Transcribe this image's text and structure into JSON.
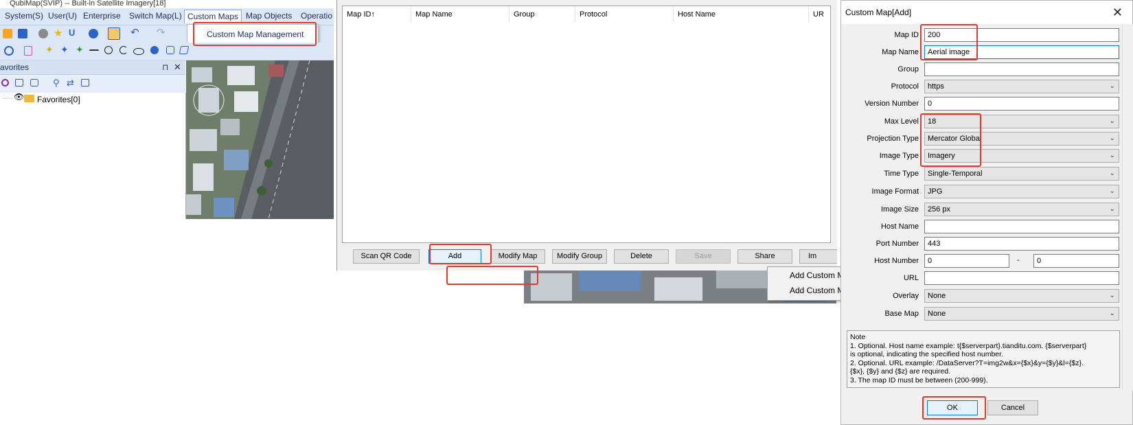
{
  "app": {
    "title": "QubiMap(SVIP) -- Built-in Satellite Imagery[18]",
    "menu": [
      "System(S)",
      "User(U)",
      "Enterprise",
      "Switch Map(L)",
      "Custom Maps",
      "Map Objects",
      "Operatio"
    ],
    "custom_maps_menu": {
      "item": "Custom Map Management"
    },
    "favorites": {
      "title": "avorites",
      "tree_item": "Favorites[0]"
    }
  },
  "manager": {
    "columns": [
      "Map ID↑",
      "Map Name",
      "Group",
      "Protocol",
      "Host Name",
      "UR"
    ],
    "buttons": [
      "Scan QR Code",
      "Add",
      "Modify Map",
      "Modify Group",
      "Delete",
      "Save",
      "Share",
      "Im"
    ],
    "add_menu": [
      "Add Custom Map",
      "Add Custom Map via WMTS Service"
    ]
  },
  "dialog": {
    "title": "Custom Map[Add]",
    "close": "✕",
    "fields": {
      "map_id": {
        "label": "Map ID",
        "value": "200"
      },
      "map_name": {
        "label": "Map Name",
        "value": "Aerial image"
      },
      "group": {
        "label": "Group",
        "value": ""
      },
      "protocol": {
        "label": "Protocol",
        "value": "https"
      },
      "version_number": {
        "label": "Version Number",
        "value": "0"
      },
      "max_level": {
        "label": "Max Level",
        "value": "18"
      },
      "projection_type": {
        "label": "Projection Type",
        "value": "Mercator Global"
      },
      "image_type": {
        "label": "Image Type",
        "value": "Imagery"
      },
      "time_type": {
        "label": "Time Type",
        "value": "Single-Temporal"
      },
      "image_format": {
        "label": "Image Format",
        "value": "JPG"
      },
      "image_size": {
        "label": "Image Size",
        "value": "256 px"
      },
      "host_name": {
        "label": "Host Name",
        "value": ""
      },
      "port_number": {
        "label": "Port Number",
        "value": "443"
      },
      "host_number": {
        "label": "Host Number",
        "from": "0",
        "separator": "-",
        "to": "0"
      },
      "url": {
        "label": "URL",
        "value": ""
      },
      "overlay": {
        "label": "Overlay",
        "value": "None"
      },
      "base_map": {
        "label": "Base Map",
        "value": "None"
      }
    },
    "note": [
      "Note",
      "1. Optional. Host name example: t{$serverpart}.tianditu.com. {$serverpart}",
      "is optional, indicating the specified host number.",
      "2. Optional. URL example: /DataServer?T=img2w&x={$x}&y={$y}&l={$z}.",
      "{$x}, {$y} and {$z} are required.",
      "3. The map ID must be between (200-999)."
    ],
    "ok": "OK",
    "cancel": "Cancel"
  },
  "colors": {
    "highlight": "#e03a2e",
    "toolbar": "#dbe7f6",
    "focus": "#0078d7"
  }
}
